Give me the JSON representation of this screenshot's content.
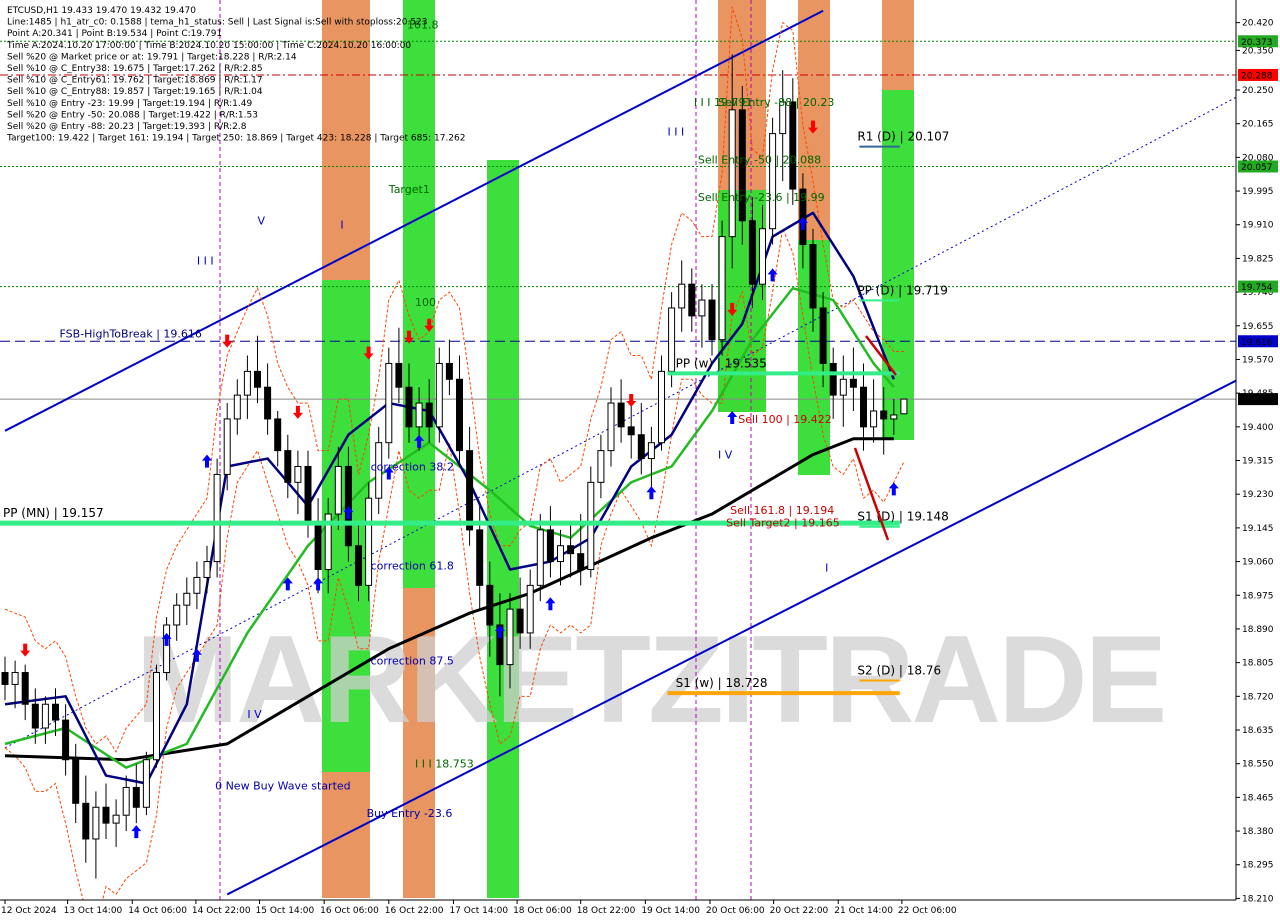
{
  "colors": {
    "background": "#ffffff",
    "channel": "#0000cc",
    "candle_up": "#ffffff",
    "candle_down": "#000000",
    "ma_fast": "#000080",
    "ma_mid": "#22bb22",
    "ma_slow": "#000000",
    "pivot_line": "#33ee88",
    "s1w_line": "#ffa500",
    "green_zone": "#33dd33",
    "orange_zone": "#e58a50",
    "target_green": "#006600",
    "red_line": "#cc0000",
    "grid_dash_green": "#008800",
    "blue_dash": "#000099",
    "envelope": "#ff4500",
    "magenta_vline": "#bb00bb",
    "arrow_up": "#0000ff",
    "arrow_down": "#ff0000",
    "watermark": "#c8c8c8"
  },
  "header": {
    "lines": [
      "ETCUSD,H1   19.433 19.470 19.432 19.470",
      "Line:1485 | h1_atr_c0: 0.1588 | tema_h1_status: Sell | Last Signal is:Sell with stoploss:20.523",
      "Point A:20.341 | Point B:19.534 | Point C:19.791",
      "Time A:2024.10.20 17:00:00 | Time B:2024.10.20 15:00:00 | Time C:2024.10.20 16:00:00",
      "Sell %20 @ Market price or at: 19.791 | Target:18.228 | R/R:2.14",
      "Sell %10 @ C_Entry38: 19.675 | Target:17.262 | R/R:2.85",
      "Sell %10 @ C_Entry61: 19.762 | Target:18.869 | R/R:1.17",
      "Sell %10 @ C_Entry88: 19.857 | Target:19.165 | R/R:1.04",
      "Sell %10 @ Entry -23: 19.99 | Target:19.194 | R/R:1.49",
      "Sell %20 @ Entry -50: 20.088 | Target:19.422 | R/R:1.53",
      "Sell %20 @ Entry -88: 20.23 | Target:19.393 | R/R:2.8",
      "Target100: 19.422 | Target 161: 19.194 | Target 250: 18.869 | Target 423: 18.228 | Target 685: 17.262"
    ]
  },
  "watermark": "MARKETZITRADE",
  "chart_data": {
    "type": "candlestick",
    "symbol": "ETCUSD,H1",
    "ylim": [
      18.206,
      20.462
    ],
    "x_tick_labels": [
      "12 Oct 2024",
      "13 Oct 14:00",
      "14 Oct 06:00",
      "14 Oct 22:00",
      "15 Oct 14:00",
      "16 Oct 06:00",
      "16 Oct 22:00",
      "17 Oct 14:00",
      "18 Oct 06:00",
      "18 Oct 22:00",
      "19 Oct 14:00",
      "20 Oct 06:00",
      "20 Oct 22:00",
      "21 Oct 14:00",
      "22 Oct 06:00"
    ],
    "y_tick_labels": [
      "20.420",
      "20.350",
      "20.250",
      "20.165",
      "20.080",
      "19.995",
      "19.910",
      "19.825",
      "19.740",
      "19.655",
      "19.570",
      "19.485",
      "19.400",
      "19.315",
      "19.230",
      "19.145",
      "19.060",
      "18.975",
      "18.890",
      "18.805",
      "18.720",
      "18.635",
      "18.550",
      "18.465",
      "18.380",
      "18.295",
      "18.210"
    ],
    "price_tags": [
      {
        "value": "20.373",
        "price": 20.373,
        "bg": "#22aa22",
        "fg": "#ffffff"
      },
      {
        "value": "20.288",
        "price": 20.288,
        "bg": "#ff0000",
        "fg": "#ffffff"
      },
      {
        "value": "20.057",
        "price": 20.057,
        "bg": "#22aa22",
        "fg": "#ffffff"
      },
      {
        "value": "19.754",
        "price": 19.754,
        "bg": "#22aa22",
        "fg": "#ffffff"
      },
      {
        "value": "19.616",
        "price": 19.616,
        "bg": "#0000cc",
        "fg": "#ffffff"
      },
      {
        "value": "19.470",
        "price": 19.47,
        "bg": "#000000",
        "fg": "#ffffff"
      }
    ],
    "candles": [
      {
        "o": 18.78,
        "h": 18.82,
        "l": 18.71,
        "c": 18.75
      },
      {
        "o": 18.75,
        "h": 18.81,
        "l": 18.69,
        "c": 18.78
      },
      {
        "o": 18.78,
        "h": 18.8,
        "l": 18.66,
        "c": 18.7
      },
      {
        "o": 18.7,
        "h": 18.74,
        "l": 18.6,
        "c": 18.64
      },
      {
        "o": 18.64,
        "h": 18.72,
        "l": 18.6,
        "c": 18.7
      },
      {
        "o": 18.7,
        "h": 18.74,
        "l": 18.62,
        "c": 18.66
      },
      {
        "o": 18.66,
        "h": 18.7,
        "l": 18.52,
        "c": 18.56
      },
      {
        "o": 18.56,
        "h": 18.6,
        "l": 18.4,
        "c": 18.45
      },
      {
        "o": 18.45,
        "h": 18.52,
        "l": 18.3,
        "c": 18.36
      },
      {
        "o": 18.36,
        "h": 18.48,
        "l": 18.26,
        "c": 18.44
      },
      {
        "o": 18.44,
        "h": 18.5,
        "l": 18.36,
        "c": 18.4
      },
      {
        "o": 18.4,
        "h": 18.46,
        "l": 18.34,
        "c": 18.42
      },
      {
        "o": 18.42,
        "h": 18.52,
        "l": 18.38,
        "c": 18.49
      },
      {
        "o": 18.49,
        "h": 18.55,
        "l": 18.4,
        "c": 18.44
      },
      {
        "o": 18.44,
        "h": 18.58,
        "l": 18.42,
        "c": 18.56
      },
      {
        "o": 18.56,
        "h": 18.8,
        "l": 18.54,
        "c": 18.78
      },
      {
        "o": 18.78,
        "h": 18.92,
        "l": 18.76,
        "c": 18.9
      },
      {
        "o": 18.9,
        "h": 18.98,
        "l": 18.86,
        "c": 18.95
      },
      {
        "o": 18.95,
        "h": 19.02,
        "l": 18.9,
        "c": 18.98
      },
      {
        "o": 18.98,
        "h": 19.06,
        "l": 18.94,
        "c": 19.02
      },
      {
        "o": 19.02,
        "h": 19.1,
        "l": 18.98,
        "c": 19.06
      },
      {
        "o": 19.06,
        "h": 19.32,
        "l": 19.02,
        "c": 19.28
      },
      {
        "o": 19.28,
        "h": 19.46,
        "l": 19.24,
        "c": 19.42
      },
      {
        "o": 19.42,
        "h": 19.52,
        "l": 19.38,
        "c": 19.48
      },
      {
        "o": 19.48,
        "h": 19.58,
        "l": 19.42,
        "c": 19.54
      },
      {
        "o": 19.54,
        "h": 19.63,
        "l": 19.46,
        "c": 19.5
      },
      {
        "o": 19.5,
        "h": 19.56,
        "l": 19.38,
        "c": 19.42
      },
      {
        "o": 19.42,
        "h": 19.44,
        "l": 19.3,
        "c": 19.34
      },
      {
        "o": 19.34,
        "h": 19.38,
        "l": 19.22,
        "c": 19.26
      },
      {
        "o": 19.26,
        "h": 19.34,
        "l": 19.18,
        "c": 19.3
      },
      {
        "o": 19.3,
        "h": 19.34,
        "l": 19.12,
        "c": 19.16
      },
      {
        "o": 19.16,
        "h": 19.22,
        "l": 18.98,
        "c": 19.04
      },
      {
        "o": 19.04,
        "h": 19.22,
        "l": 18.98,
        "c": 19.18
      },
      {
        "o": 19.18,
        "h": 19.35,
        "l": 19.14,
        "c": 19.3
      },
      {
        "o": 19.3,
        "h": 19.35,
        "l": 19.06,
        "c": 19.1
      },
      {
        "o": 19.1,
        "h": 19.16,
        "l": 18.96,
        "c": 19.0
      },
      {
        "o": 19.0,
        "h": 19.26,
        "l": 18.96,
        "c": 19.22
      },
      {
        "o": 19.22,
        "h": 19.4,
        "l": 19.18,
        "c": 19.36
      },
      {
        "o": 19.36,
        "h": 19.6,
        "l": 19.32,
        "c": 19.56
      },
      {
        "o": 19.56,
        "h": 19.65,
        "l": 19.46,
        "c": 19.5
      },
      {
        "o": 19.5,
        "h": 19.56,
        "l": 19.36,
        "c": 19.4
      },
      {
        "o": 19.4,
        "h": 19.5,
        "l": 19.34,
        "c": 19.46
      },
      {
        "o": 19.46,
        "h": 19.52,
        "l": 19.36,
        "c": 19.4
      },
      {
        "o": 19.4,
        "h": 19.6,
        "l": 19.36,
        "c": 19.56
      },
      {
        "o": 19.56,
        "h": 19.62,
        "l": 19.48,
        "c": 19.52
      },
      {
        "o": 19.52,
        "h": 19.58,
        "l": 19.3,
        "c": 19.34
      },
      {
        "o": 19.34,
        "h": 19.4,
        "l": 19.1,
        "c": 19.14
      },
      {
        "o": 19.14,
        "h": 19.2,
        "l": 18.94,
        "c": 19.0
      },
      {
        "o": 19.0,
        "h": 19.06,
        "l": 18.82,
        "c": 18.9
      },
      {
        "o": 18.9,
        "h": 18.98,
        "l": 18.72,
        "c": 18.8
      },
      {
        "o": 18.8,
        "h": 18.98,
        "l": 18.74,
        "c": 18.94
      },
      {
        "o": 18.94,
        "h": 19.02,
        "l": 18.84,
        "c": 18.88
      },
      {
        "o": 18.88,
        "h": 19.04,
        "l": 18.84,
        "c": 19.0
      },
      {
        "o": 19.0,
        "h": 19.18,
        "l": 18.96,
        "c": 19.14
      },
      {
        "o": 19.14,
        "h": 19.2,
        "l": 19.02,
        "c": 19.06
      },
      {
        "o": 19.06,
        "h": 19.14,
        "l": 19.0,
        "c": 19.1
      },
      {
        "o": 19.1,
        "h": 19.16,
        "l": 19.02,
        "c": 19.08
      },
      {
        "o": 19.08,
        "h": 19.18,
        "l": 19.0,
        "c": 19.04
      },
      {
        "o": 19.04,
        "h": 19.3,
        "l": 19.02,
        "c": 19.26
      },
      {
        "o": 19.26,
        "h": 19.38,
        "l": 19.22,
        "c": 19.34
      },
      {
        "o": 19.34,
        "h": 19.5,
        "l": 19.3,
        "c": 19.46
      },
      {
        "o": 19.46,
        "h": 19.52,
        "l": 19.36,
        "c": 19.4
      },
      {
        "o": 19.4,
        "h": 19.46,
        "l": 19.32,
        "c": 19.38
      },
      {
        "o": 19.38,
        "h": 19.46,
        "l": 19.28,
        "c": 19.32
      },
      {
        "o": 19.32,
        "h": 19.4,
        "l": 19.22,
        "c": 19.36
      },
      {
        "o": 19.36,
        "h": 19.58,
        "l": 19.34,
        "c": 19.54
      },
      {
        "o": 19.54,
        "h": 19.74,
        "l": 19.5,
        "c": 19.7
      },
      {
        "o": 19.7,
        "h": 19.82,
        "l": 19.64,
        "c": 19.76
      },
      {
        "o": 19.76,
        "h": 19.8,
        "l": 19.64,
        "c": 19.68
      },
      {
        "o": 19.68,
        "h": 19.76,
        "l": 19.6,
        "c": 19.72
      },
      {
        "o": 19.72,
        "h": 19.76,
        "l": 19.58,
        "c": 19.62
      },
      {
        "o": 19.62,
        "h": 19.92,
        "l": 19.58,
        "c": 19.88
      },
      {
        "o": 19.88,
        "h": 20.34,
        "l": 19.8,
        "c": 20.2
      },
      {
        "o": 20.2,
        "h": 20.26,
        "l": 19.86,
        "c": 19.92
      },
      {
        "o": 19.92,
        "h": 19.98,
        "l": 19.7,
        "c": 19.76
      },
      {
        "o": 19.76,
        "h": 19.96,
        "l": 19.72,
        "c": 19.9
      },
      {
        "o": 19.9,
        "h": 20.18,
        "l": 19.86,
        "c": 20.14
      },
      {
        "o": 20.14,
        "h": 20.3,
        "l": 20.02,
        "c": 20.22
      },
      {
        "o": 20.22,
        "h": 20.28,
        "l": 19.96,
        "c": 20.0
      },
      {
        "o": 20.0,
        "h": 20.04,
        "l": 19.8,
        "c": 19.86
      },
      {
        "o": 19.86,
        "h": 19.9,
        "l": 19.64,
        "c": 19.7
      },
      {
        "o": 19.7,
        "h": 19.74,
        "l": 19.5,
        "c": 19.56
      },
      {
        "o": 19.56,
        "h": 19.6,
        "l": 19.42,
        "c": 19.48
      },
      {
        "o": 19.48,
        "h": 19.58,
        "l": 19.4,
        "c": 19.52
      },
      {
        "o": 19.52,
        "h": 19.6,
        "l": 19.44,
        "c": 19.5
      },
      {
        "o": 19.5,
        "h": 19.56,
        "l": 19.34,
        "c": 19.4
      },
      {
        "o": 19.4,
        "h": 19.52,
        "l": 19.36,
        "c": 19.44
      },
      {
        "o": 19.44,
        "h": 19.5,
        "l": 19.33,
        "c": 19.42
      },
      {
        "o": 19.42,
        "h": 19.47,
        "l": 19.38,
        "c": 19.43
      },
      {
        "o": 19.433,
        "h": 19.47,
        "l": 19.432,
        "c": 19.47
      }
    ],
    "ma_slow": [
      [
        0,
        18.57
      ],
      [
        12,
        18.56
      ],
      [
        22,
        18.6
      ],
      [
        30,
        18.72
      ],
      [
        38,
        18.84
      ],
      [
        46,
        18.93
      ],
      [
        52,
        18.98
      ],
      [
        58,
        19.05
      ],
      [
        64,
        19.12
      ],
      [
        70,
        19.18
      ],
      [
        76,
        19.27
      ],
      [
        80,
        19.33
      ],
      [
        84,
        19.37
      ],
      [
        88,
        19.37
      ]
    ],
    "ma_mid": [
      [
        0,
        18.6
      ],
      [
        6,
        18.64
      ],
      [
        12,
        18.54
      ],
      [
        18,
        18.6
      ],
      [
        24,
        18.88
      ],
      [
        30,
        19.1
      ],
      [
        36,
        19.26
      ],
      [
        42,
        19.36
      ],
      [
        48,
        19.24
      ],
      [
        52,
        19.15
      ],
      [
        56,
        19.12
      ],
      [
        62,
        19.26
      ],
      [
        66,
        19.3
      ],
      [
        70,
        19.44
      ],
      [
        74,
        19.62
      ],
      [
        78,
        19.75
      ],
      [
        82,
        19.72
      ],
      [
        86,
        19.56
      ],
      [
        88,
        19.5
      ]
    ],
    "ma_fast": [
      [
        0,
        18.7
      ],
      [
        6,
        18.72
      ],
      [
        10,
        18.52
      ],
      [
        14,
        18.5
      ],
      [
        18,
        18.7
      ],
      [
        22,
        19.3
      ],
      [
        26,
        19.32
      ],
      [
        30,
        19.2
      ],
      [
        34,
        19.38
      ],
      [
        38,
        19.46
      ],
      [
        42,
        19.44
      ],
      [
        46,
        19.26
      ],
      [
        50,
        19.04
      ],
      [
        54,
        19.06
      ],
      [
        58,
        19.12
      ],
      [
        62,
        19.3
      ],
      [
        66,
        19.38
      ],
      [
        70,
        19.56
      ],
      [
        73,
        19.66
      ],
      [
        76,
        19.88
      ],
      [
        80,
        19.94
      ],
      [
        84,
        19.78
      ],
      [
        88,
        19.52
      ]
    ],
    "channel_upper": [
      [
        0,
        19.39
      ],
      [
        81,
        20.45
      ]
    ],
    "channel_lower": [
      [
        22,
        18.22
      ],
      [
        126,
        19.57
      ]
    ],
    "channel_mid_dotted": [
      [
        0,
        18.59
      ],
      [
        124,
        20.26
      ]
    ],
    "levels": [
      {
        "label": "PP (MN) | 19.157",
        "price": 19.157,
        "x0": 0,
        "x1": 88,
        "label_x": 0,
        "color": "#33ee88",
        "width": 5
      },
      {
        "label": "PP (w) | 19.535",
        "price": 19.535,
        "x0": 65,
        "x1": 88,
        "label_x": 66,
        "color": "#33ee88",
        "width": 4
      },
      {
        "label": "S1 (w) | 18.728",
        "price": 18.728,
        "x0": 65,
        "x1": 88,
        "label_x": 66,
        "color": "#ffa500",
        "width": 4
      },
      {
        "label": "PP (D) | 19.719",
        "price": 19.719,
        "x0": 84,
        "x1": 88,
        "label_x": 84,
        "color": "#33ee88",
        "width": 2
      },
      {
        "label": "R1 (D) | 20.107",
        "price": 20.107,
        "x0": 84,
        "x1": 88,
        "label_x": 84,
        "color": "#336699",
        "width": 2
      },
      {
        "label": "S1 (D) | 19.148",
        "price": 19.148,
        "x0": 84,
        "x1": 88,
        "label_x": 84,
        "color": "#33ee88",
        "width": 2
      },
      {
        "label": "S2 (D) | 18.76",
        "price": 18.76,
        "x0": 84,
        "x1": 88,
        "label_x": 84,
        "color": "#ffa500",
        "width": 2
      }
    ],
    "dashed_levels": [
      {
        "price": 20.373,
        "color": "#008800",
        "style": "dotted"
      },
      {
        "price": 20.288,
        "color": "#cc0000",
        "style": "dashdot"
      },
      {
        "price": 20.057,
        "color": "#008800",
        "style": "dotted"
      },
      {
        "price": 19.754,
        "color": "#008800",
        "style": "dotted"
      },
      {
        "price": 19.616,
        "color": "#000099",
        "style": "dashed"
      },
      {
        "price": 19.47,
        "color": "#888888",
        "style": "solid"
      }
    ],
    "annotations": [
      {
        "text": "FSB-HighToBreak | 19.616",
        "x": 5.4,
        "price": 19.625,
        "color": "#000080"
      },
      {
        "text": "161.8",
        "x": 39.8,
        "price": 20.405,
        "color": "#006600"
      },
      {
        "text": "Target1",
        "x": 38.0,
        "price": 19.99,
        "color": "#006600"
      },
      {
        "text": "100",
        "x": 40.6,
        "price": 19.705,
        "color": "#006600"
      },
      {
        "text": "correction 38.2",
        "x": 36.2,
        "price": 19.29,
        "color": "#0000aa"
      },
      {
        "text": "correction 61.8",
        "x": 36.2,
        "price": 19.04,
        "color": "#0000aa"
      },
      {
        "text": "correction 87.5",
        "x": 36.2,
        "price": 18.8,
        "color": "#0000aa"
      },
      {
        "text": "0 New Buy Wave started",
        "x": 20.8,
        "price": 18.485,
        "color": "#0000aa"
      },
      {
        "text": "Buy Entry -23.6",
        "x": 35.8,
        "price": 18.415,
        "color": "#0000aa"
      },
      {
        "text": "I I I 18.753",
        "x": 40.6,
        "price": 18.54,
        "color": "#006600"
      },
      {
        "text": "Sell 100 | 19.422",
        "x": 72.6,
        "price": 19.41,
        "color": "#cc0000"
      },
      {
        "text": "Sell 161.8 | 19.194",
        "x": 71.8,
        "price": 19.18,
        "color": "#cc0000"
      },
      {
        "text": "Sell Target2 | 19.165",
        "x": 71.4,
        "price": 19.148,
        "color": "#cc0000"
      },
      {
        "text": "Sell Entry -50 | 20.088",
        "x": 68.6,
        "price": 20.065,
        "color": "#006600"
      },
      {
        "text": "Sell Entry -23.6 | 19.99",
        "x": 68.6,
        "price": 19.97,
        "color": "#006600"
      },
      {
        "text": "I I I 19.791",
        "x": 68.2,
        "price": 20.21,
        "color": "#006600"
      },
      {
        "text": "Sell Entry -88 | 20.23",
        "x": 70.6,
        "price": 20.21,
        "color": "#006600"
      }
    ],
    "wave_labels": [
      {
        "text": "V",
        "x": 25.0,
        "price": 19.91
      },
      {
        "text": "I",
        "x": 33.2,
        "price": 19.9
      },
      {
        "text": "I I I",
        "x": 19.0,
        "price": 19.81
      },
      {
        "text": "I V",
        "x": 24.0,
        "price": 18.665
      },
      {
        "text": "I I I",
        "x": 65.6,
        "price": 20.135
      },
      {
        "text": "I V",
        "x": 70.6,
        "price": 19.32
      },
      {
        "text": "I",
        "x": 81.2,
        "price": 19.035
      }
    ]
  }
}
